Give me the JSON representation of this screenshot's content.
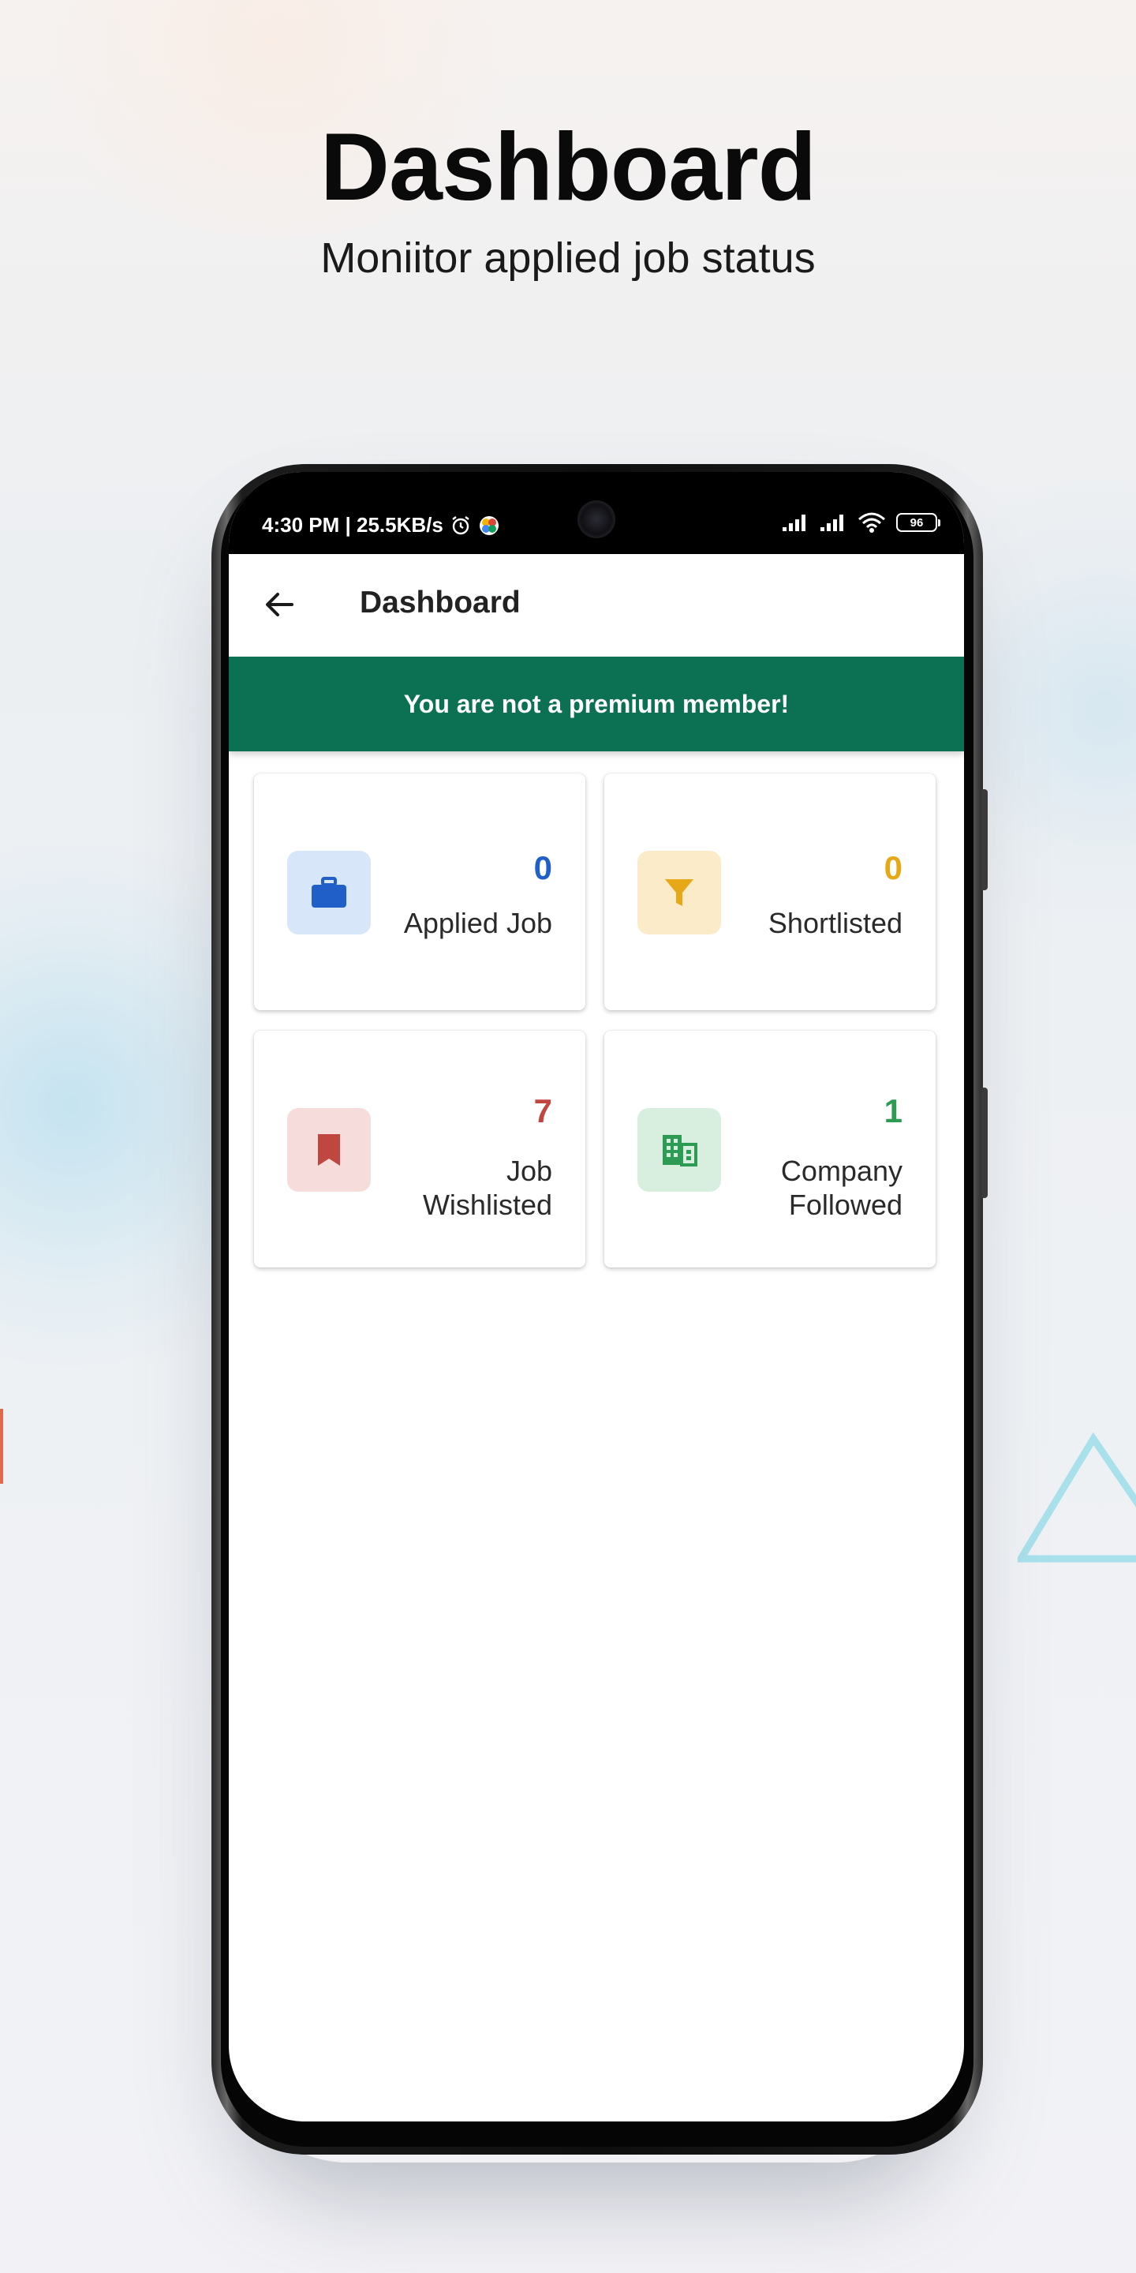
{
  "hero": {
    "title": "Dashboard",
    "subtitle": "Moniitor applied job status"
  },
  "statusbar": {
    "time_speed": "4:30 PM | 25.5KB/s",
    "battery": "96",
    "icons": [
      "alarm-icon",
      "app-notification-icon",
      "signal-icon",
      "signal-icon",
      "wifi-icon",
      "battery-icon"
    ]
  },
  "appbar": {
    "title": "Dashboard",
    "back_icon": "arrow-left-icon"
  },
  "banner": {
    "text": "You are not a premium member!",
    "color": "#0b7152"
  },
  "cards": [
    {
      "count": "0",
      "label": "Applied Job",
      "icon": "briefcase-icon",
      "accent": "#1f5fc7",
      "icon_bg": "#d7e6f8"
    },
    {
      "count": "0",
      "label": "Shortlisted",
      "icon": "filter-icon",
      "accent": "#e7a817",
      "icon_bg": "#fcebc8"
    },
    {
      "count": "7",
      "label": "Job Wishlisted",
      "label_lines": [
        "Job",
        "Wishlisted"
      ],
      "icon": "bookmark-icon",
      "accent": "#c0473f",
      "icon_bg": "#f6dcda"
    },
    {
      "count": "1",
      "label": "Company Followed",
      "label_lines": [
        "Company",
        "Followed"
      ],
      "icon": "building-icon",
      "accent": "#2e9b55",
      "icon_bg": "#d8efe0"
    }
  ]
}
